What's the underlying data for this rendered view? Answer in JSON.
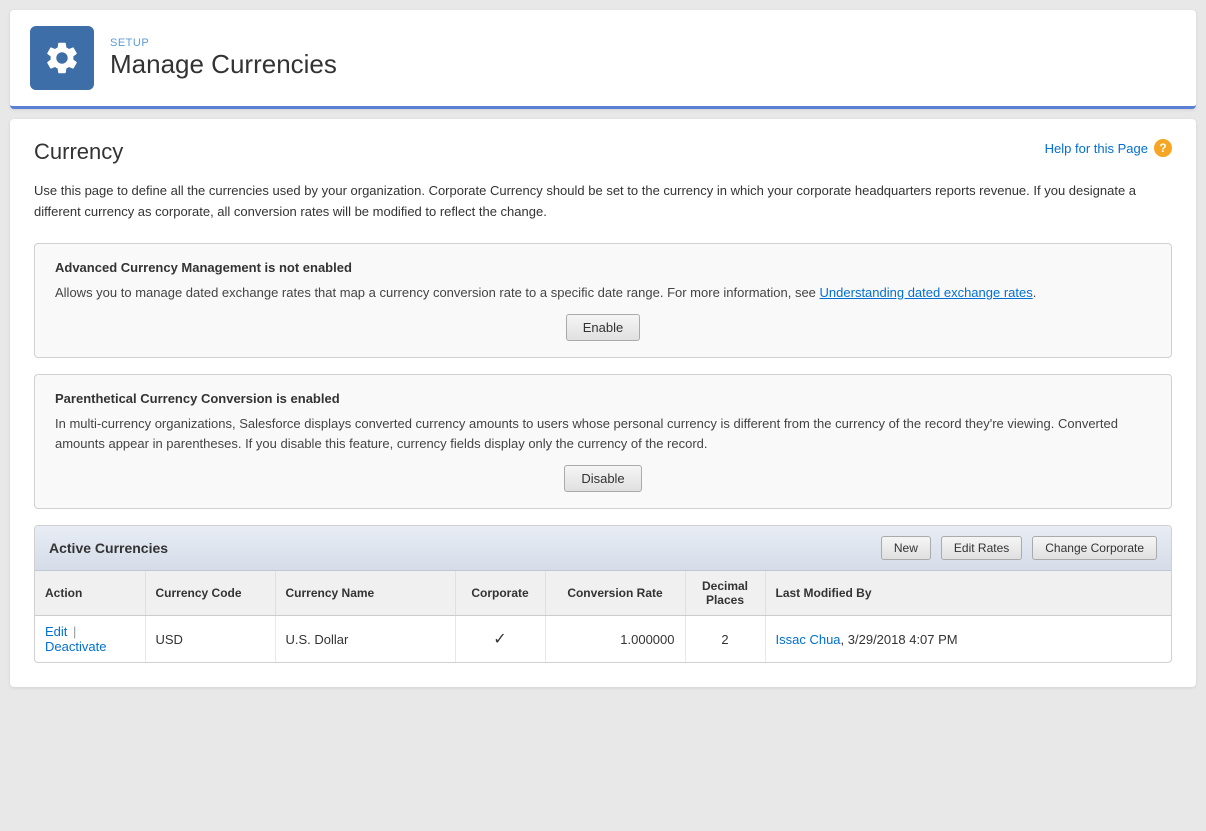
{
  "header": {
    "setup_label": "SETUP",
    "title": "Manage Currencies",
    "icon_label": "gear-icon"
  },
  "page": {
    "title": "Currency",
    "help_link": "Help for this Page",
    "description": "Use this page to define all the currencies used by your organization. Corporate Currency should be set to the currency in which your corporate headquarters reports revenue. If you designate a different currency as corporate, all conversion rates will be modified to reflect the change."
  },
  "acm_box": {
    "title": "Advanced Currency Management is not enabled",
    "body": "Allows you to manage dated exchange rates that map a currency conversion rate to a specific date range. For more information, see",
    "link_text": "Understanding dated exchange rates",
    "period": ".",
    "button_label": "Enable"
  },
  "pcc_box": {
    "title": "Parenthetical Currency Conversion is enabled",
    "body": "In multi-currency organizations, Salesforce displays converted currency amounts to users whose personal currency is different from the currency of the record they're viewing. Converted amounts appear in parentheses. If you disable this feature, currency fields display only the currency of the record.",
    "button_label": "Disable"
  },
  "active_currencies": {
    "title": "Active Currencies",
    "buttons": {
      "new": "New",
      "edit_rates": "Edit Rates",
      "change_corporate": "Change Corporate"
    },
    "columns": {
      "action": "Action",
      "currency_code": "Currency Code",
      "currency_name": "Currency Name",
      "corporate": "Corporate",
      "conversion_rate": "Conversion Rate",
      "decimal_places": "Decimal Places",
      "last_modified_by": "Last Modified By"
    },
    "rows": [
      {
        "action_edit": "Edit",
        "action_deactivate": "Deactivate",
        "currency_code": "USD",
        "currency_name": "U.S. Dollar",
        "is_corporate": true,
        "conversion_rate": "1.000000",
        "decimal_places": "2",
        "modified_by_name": "Issac Chua",
        "modified_date": ", 3/29/2018 4:07 PM"
      }
    ]
  }
}
